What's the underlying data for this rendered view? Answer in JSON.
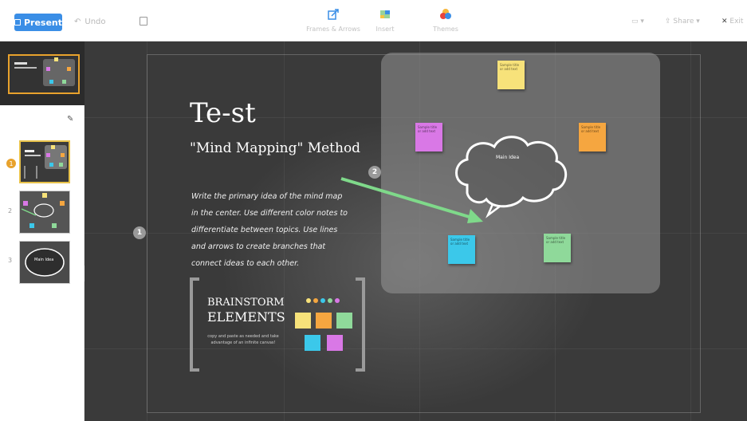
{
  "toolbar": {
    "present_label": "Present",
    "undo_label": "Undo",
    "tools": [
      {
        "label": "Frames & Arrows",
        "icon": "frames-arrows-icon"
      },
      {
        "label": "Insert",
        "icon": "insert-icon"
      },
      {
        "label": "Themes",
        "icon": "themes-icon"
      }
    ],
    "share_label": "Share",
    "exit_label": "Exit"
  },
  "sidebar": {
    "slides": [
      {
        "number": "1",
        "active": true
      },
      {
        "number": "2",
        "active": false
      },
      {
        "number": "3",
        "active": false,
        "caption": "Main Idea"
      }
    ]
  },
  "canvas": {
    "title": "Te-st",
    "subtitle": "\"Mind Mapping\" Method",
    "body": "Write the primary idea of the mind map in the center. Use different color notes to differentiate between topics. Use lines and arrows to create branches that connect ideas to each other.",
    "step_markers": [
      "1",
      "2"
    ],
    "cloud_label": "Main Idea",
    "brainstorm": {
      "line1": "BRAINSTORM",
      "line2": "ELEMENTS",
      "caption": "copy and paste as needed and take advantage of an infinite canvas!"
    },
    "note_text": "Sample title or add text"
  },
  "colors": {
    "accent": "#3a8ee6",
    "highlight": "#e8a22c",
    "canvas_bg": "#3a3a3a",
    "arrow": "#7fd98a",
    "note_yellow": "#f7e27a",
    "note_orange": "#f5a640",
    "note_pink": "#d978e6",
    "note_cyan": "#3bc8ea",
    "note_green": "#8fd99a"
  }
}
